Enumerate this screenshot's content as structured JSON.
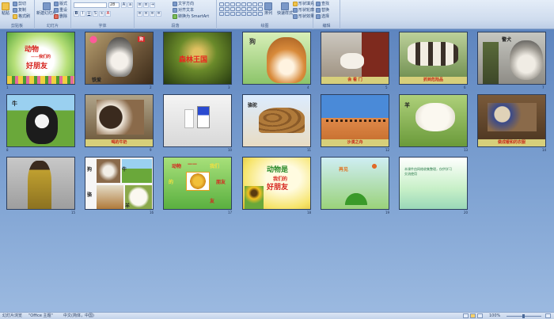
{
  "ribbon": {
    "groups": [
      {
        "label": "剪贴板",
        "buttons": [
          "剪切",
          "复制",
          "格式刷"
        ],
        "paste": "粘贴"
      },
      {
        "label": "幻灯片",
        "buttons": [
          "版式",
          "重设",
          "删除"
        ],
        "new_slide": "新建幻灯片"
      },
      {
        "label": "字体",
        "font_size": "28"
      },
      {
        "label": "段落",
        "buttons": [
          "文字方向",
          "对齐文本",
          "转换为 SmartArt"
        ]
      },
      {
        "label": "绘图",
        "buttons": [
          "排列",
          "快速样式"
        ],
        "fill_buttons": [
          "形状填充",
          "形状轮廓",
          "形状效果"
        ]
      },
      {
        "label": "编辑",
        "buttons": [
          "查找",
          "替换",
          "选择"
        ]
      }
    ]
  },
  "slides": [
    {
      "num": "1",
      "texts": [
        "动物",
        "——我们的",
        "好朋友"
      ]
    },
    {
      "num": "2",
      "texts": [
        "铁爱",
        "狗"
      ]
    },
    {
      "num": "3",
      "texts": [
        "森林王国"
      ]
    },
    {
      "num": "4",
      "texts": [
        "狗"
      ]
    },
    {
      "num": "5",
      "texts": [
        "会 看 门"
      ]
    },
    {
      "num": "6",
      "texts": [
        "抓到危险品"
      ]
    },
    {
      "num": "7",
      "texts": [
        "警犬"
      ]
    },
    {
      "num": "8",
      "texts": [
        "牛"
      ]
    },
    {
      "num": "9",
      "texts": [
        "喝的牛奶"
      ]
    },
    {
      "num": "10",
      "texts": []
    },
    {
      "num": "11",
      "texts": [
        "骆驼"
      ]
    },
    {
      "num": "12",
      "texts": [
        "沙漠之舟"
      ]
    },
    {
      "num": "13",
      "texts": [
        "羊"
      ]
    },
    {
      "num": "14",
      "texts": [
        "做成暖和的衣服"
      ]
    },
    {
      "num": "15",
      "texts": []
    },
    {
      "num": "16",
      "texts": [
        "狗",
        "牛",
        "骆",
        "羊"
      ]
    },
    {
      "num": "17",
      "texts": [
        "动物",
        "——",
        "我们",
        "的",
        "朋友",
        "友"
      ]
    },
    {
      "num": "18",
      "texts": [
        "动物是",
        "我们的",
        "好朋友"
      ]
    },
    {
      "num": "19",
      "texts": [
        "再见"
      ]
    },
    {
      "num": "20",
      "texts": [
        "本课件由网络收集整理，仅供学习交流使用"
      ]
    }
  ],
  "status": {
    "slide_view": "幻灯片浏览",
    "theme": "\"Office 主题\"",
    "language": "中文(简体，中国)",
    "zoom": "100%"
  }
}
